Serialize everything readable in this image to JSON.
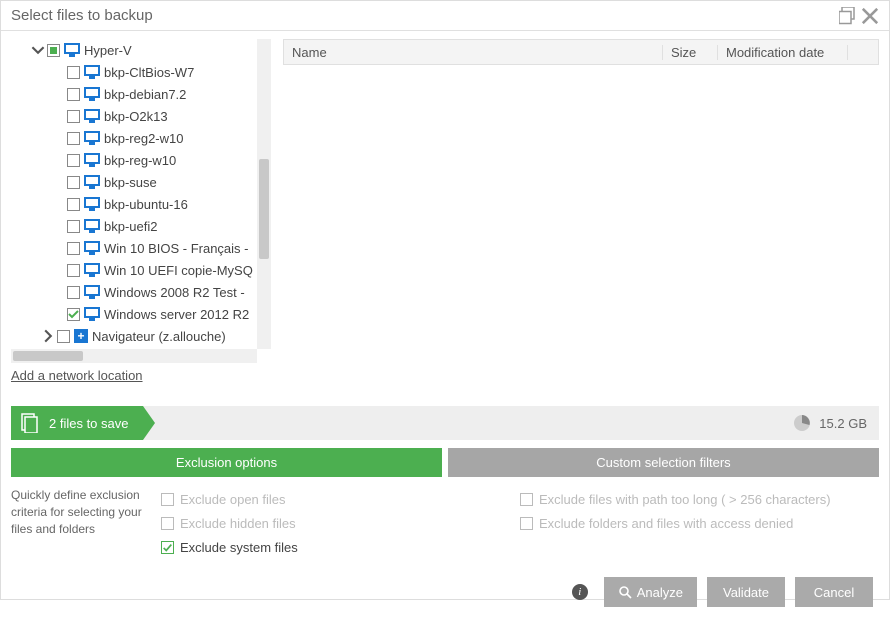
{
  "title": "Select files to backup",
  "tree": {
    "root": {
      "label": "Hyper-V"
    },
    "children": [
      {
        "label": "bkp-CltBios-W7",
        "checked": false
      },
      {
        "label": "bkp-debian7.2",
        "checked": false
      },
      {
        "label": "bkp-O2k13",
        "checked": false
      },
      {
        "label": "bkp-reg2-w10",
        "checked": false
      },
      {
        "label": "bkp-reg-w10",
        "checked": false
      },
      {
        "label": "bkp-suse",
        "checked": false
      },
      {
        "label": "bkp-ubuntu-16",
        "checked": false
      },
      {
        "label": "bkp-uefi2",
        "checked": false
      },
      {
        "label": "Win 10 BIOS - Français -",
        "checked": false
      },
      {
        "label": "Win 10 UEFI copie-MySQ",
        "checked": false
      },
      {
        "label": "Windows 2008 R2 Test -",
        "checked": false
      },
      {
        "label": "Windows server 2012 R2",
        "checked": true
      }
    ],
    "sibling": {
      "label": "Navigateur (z.allouche)"
    }
  },
  "add_network": "Add a network location",
  "list": {
    "headers": {
      "name": "Name",
      "size": "Size",
      "mod": "Modification date"
    }
  },
  "status": {
    "files": "2 files to save",
    "size": "15.2 GB"
  },
  "tabs": {
    "exclusion": "Exclusion options",
    "custom": "Custom selection filters"
  },
  "exclusion": {
    "desc": "Quickly define exclusion criteria for selecting your files and folders",
    "open": "Exclude open files",
    "hidden": "Exclude hidden files",
    "system": "Exclude system files",
    "pathlong": "Exclude files with path too long ( > 256 characters)",
    "denied": "Exclude folders and files with access denied"
  },
  "buttons": {
    "analyze": "Analyze",
    "validate": "Validate",
    "cancel": "Cancel"
  }
}
